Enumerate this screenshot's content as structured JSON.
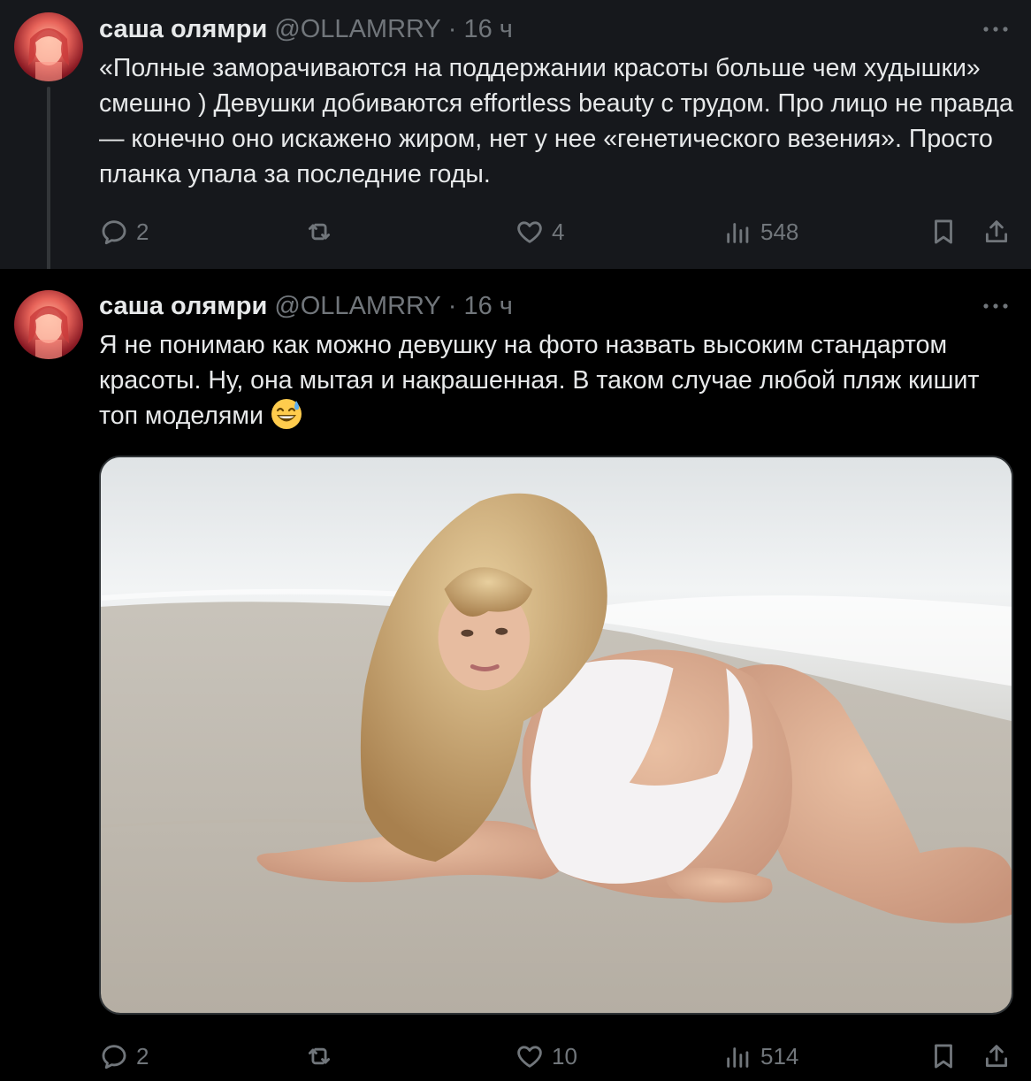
{
  "colors": {
    "background": "#000000",
    "highlighted_background": "#16181c",
    "text": "#e7e9ea",
    "secondary": "#71767b"
  },
  "tweets": [
    {
      "author": {
        "name": "саша олямри",
        "handle": "@OLLAMRRY",
        "separator": "·",
        "time": "16 ч"
      },
      "text": "«Полные заморачиваются на поддержании красоты больше чем худышки» смешно ) Девушки добиваются effortless beauty с трудом. Про лицо не правда — конечно оно искажено жиром, нет у нее «генетического везения». Просто планка упала за последние годы.",
      "actions": {
        "replies": "2",
        "reposts": "",
        "likes": "4",
        "views": "548"
      }
    },
    {
      "author": {
        "name": "саша олямри",
        "handle": "@OLLAMRRY",
        "separator": "·",
        "time": "16 ч"
      },
      "text": "Я не понимаю как можно девушку на фото назвать высоким стандартом красоты. Ну, она мытая и накрашенная. В таком случае любой пляж кишит топ моделями",
      "emoji": "grinning-face-with-sweat",
      "media": {
        "type": "photo",
        "subject": "beach photo"
      },
      "actions": {
        "replies": "2",
        "reposts": "",
        "likes": "10",
        "views": "514"
      }
    }
  ]
}
